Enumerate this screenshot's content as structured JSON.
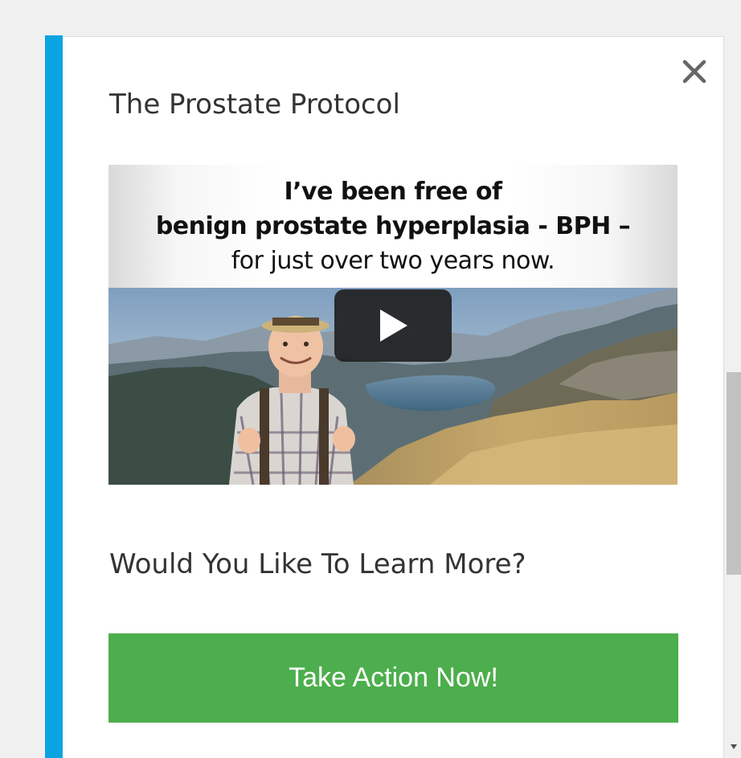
{
  "popup": {
    "title": "The Prostate Protocol",
    "close_icon": "close-icon",
    "video": {
      "caption_line1": "I’ve been free of",
      "caption_line2": "benign prostate hyperplasia - BPH –",
      "caption_line3": "for just over two years now.",
      "play_icon": "play-icon"
    },
    "question": "Would You Like To Learn More?",
    "cta_label": "Take Action Now!"
  },
  "colors": {
    "accent": "#0aa4e2",
    "cta_background": "#4cae4c",
    "text": "#333333"
  }
}
